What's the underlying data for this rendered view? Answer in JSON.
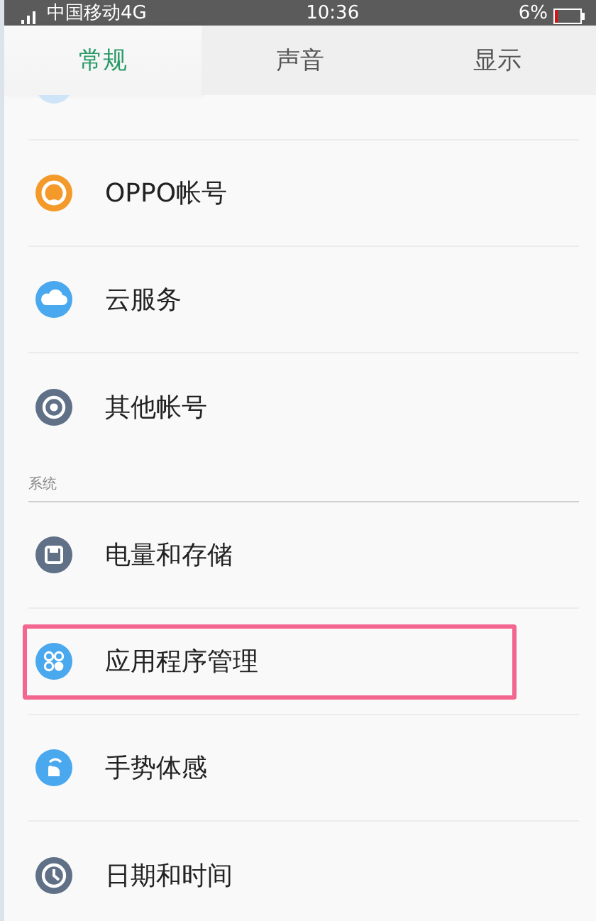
{
  "status_bar": {
    "carrier": "中国移动4G",
    "time": "10:36",
    "battery": "6%"
  },
  "tabs": [
    {
      "label": "常规",
      "selected": true
    },
    {
      "label": "声音",
      "selected": false
    },
    {
      "label": "显示",
      "selected": false
    }
  ],
  "groups": [
    {
      "items": [
        {
          "label": "OPPO帐号",
          "color": "#f39a2b",
          "highlighted": false
        },
        {
          "label": "云服务",
          "color": "#4aa8ee",
          "highlighted": false
        },
        {
          "label": "其他帐号",
          "color": "#5f7087",
          "highlighted": false
        }
      ]
    },
    {
      "header": "系统",
      "items": [
        {
          "label": "电量和存储",
          "color": "#5f7087",
          "highlighted": false
        },
        {
          "label": "应用程序管理",
          "color": "#4aa8ee",
          "highlighted": true
        },
        {
          "label": "手势体感",
          "color": "#4aa8ee",
          "highlighted": false
        },
        {
          "label": "日期和时间",
          "color": "#5f7087",
          "highlighted": false
        }
      ]
    }
  ]
}
